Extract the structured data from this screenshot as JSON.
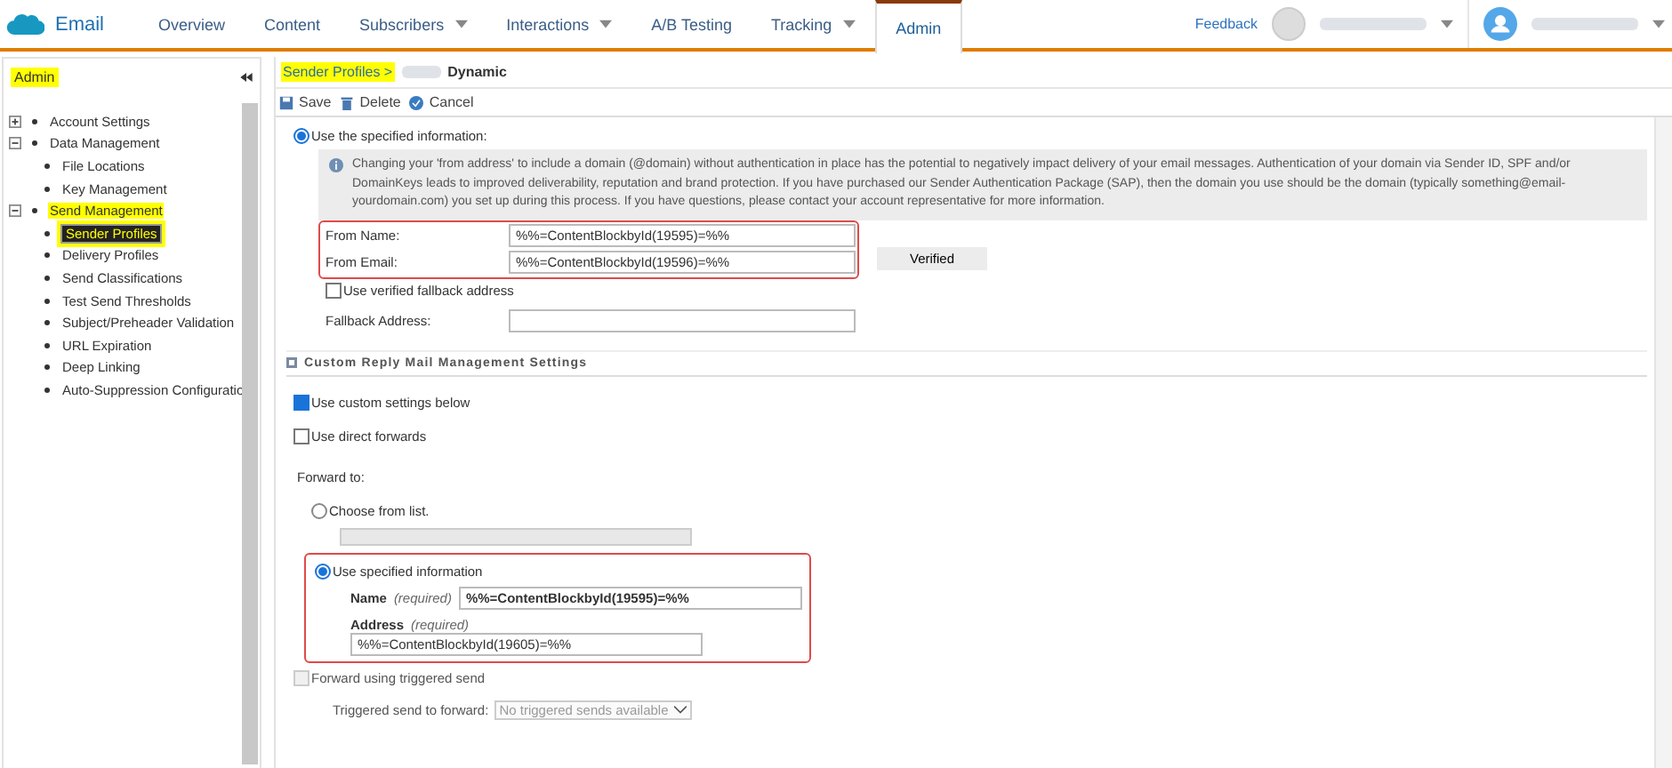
{
  "app": {
    "title": "Email"
  },
  "nav": [
    {
      "label": "Overview",
      "dropdown": false,
      "selected": false
    },
    {
      "label": "Content",
      "dropdown": false,
      "selected": false
    },
    {
      "label": "Subscribers",
      "dropdown": true,
      "selected": false
    },
    {
      "label": "Interactions",
      "dropdown": true,
      "selected": false
    },
    {
      "label": "A/B Testing",
      "dropdown": false,
      "selected": false
    },
    {
      "label": "Tracking",
      "dropdown": true,
      "selected": false
    },
    {
      "label": "Admin",
      "dropdown": false,
      "selected": true
    }
  ],
  "header_right": {
    "feedback": "Feedback"
  },
  "sidebar": {
    "title": "Admin",
    "title_highlighted": true,
    "items": [
      {
        "label": "Account Settings",
        "expanded": false,
        "highlighted": false,
        "selected": false
      },
      {
        "label": "Data Management",
        "expanded": true,
        "highlighted": false,
        "selected": false,
        "children": [
          {
            "label": "File Locations",
            "highlighted": false,
            "selected": false
          },
          {
            "label": "Key Management",
            "highlighted": false,
            "selected": false
          }
        ]
      },
      {
        "label": "Send Management",
        "expanded": true,
        "highlighted": true,
        "selected": false,
        "children": [
          {
            "label": "Sender Profiles",
            "highlighted": true,
            "selected": true
          },
          {
            "label": "Delivery Profiles",
            "highlighted": false,
            "selected": false
          },
          {
            "label": "Send Classifications",
            "highlighted": false,
            "selected": false
          },
          {
            "label": "Test Send Thresholds",
            "highlighted": false,
            "selected": false
          },
          {
            "label": "Subject/Preheader Validation",
            "highlighted": false,
            "selected": false
          },
          {
            "label": "URL Expiration",
            "highlighted": false,
            "selected": false
          },
          {
            "label": "Deep Linking",
            "highlighted": false,
            "selected": false
          },
          {
            "label": "Auto-Suppression Configuratio",
            "highlighted": false,
            "selected": false
          }
        ]
      }
    ]
  },
  "breadcrumb": {
    "link": "Sender Profiles >",
    "link_highlighted": true,
    "current": "Dynamic"
  },
  "toolbar": [
    {
      "kind": "save",
      "label": "Save"
    },
    {
      "kind": "delete",
      "label": "Delete"
    },
    {
      "kind": "cancel",
      "label": "Cancel"
    }
  ],
  "sender": {
    "option": {
      "label": "Use the specified information:",
      "selected": true
    },
    "info": "Changing your 'from address' to include a domain (@domain) without authentication in place has the potential to negatively impact delivery of your email messages. Authentication of your domain via Sender ID, SPF and/or DomainKeys leads to improved deliverability, reputation and brand protection. If you have purchased our Sender Authentication Package (SAP), then the domain you use should be the domain (typically something@email-yourdomain.com) you set up during this process. If you have questions, please contact your account representative for more information.",
    "outlined": true,
    "from_name": {
      "label": "From Name:",
      "value": "%%=ContentBlockbyId(19595)=%%"
    },
    "from_email": {
      "label": "From Email:",
      "value": "%%=ContentBlockbyId(19596)=%%"
    },
    "verified_button": "Verified",
    "fallback_check": {
      "label": "Use verified fallback address",
      "checked": false
    },
    "fallback_address": {
      "label": "Fallback Address:"
    }
  },
  "reply": {
    "title": "Custom Reply Mail Management Settings",
    "custom": {
      "label": "Use custom settings below",
      "checked": true
    },
    "direct": {
      "label": "Use direct forwards",
      "checked": false
    },
    "forward_to": "Forward to:",
    "choose": {
      "label": "Choose from list.",
      "selected": false
    },
    "specified": {
      "label": "Use specified information",
      "selected": true,
      "outlined": true,
      "name": {
        "label": "Name",
        "hint": "(required)",
        "value": "%%=ContentBlockbyId(19595)=%%"
      },
      "address": {
        "label": "Address",
        "hint": "(required)",
        "value": "%%=ContentBlockbyId(19605)=%%"
      }
    },
    "triggered": {
      "label": "Forward using triggered send",
      "checked": false,
      "disabled": true
    },
    "triggered_select": {
      "label": "Triggered send to forward:",
      "value": "No triggered sends available",
      "disabled": true
    }
  }
}
